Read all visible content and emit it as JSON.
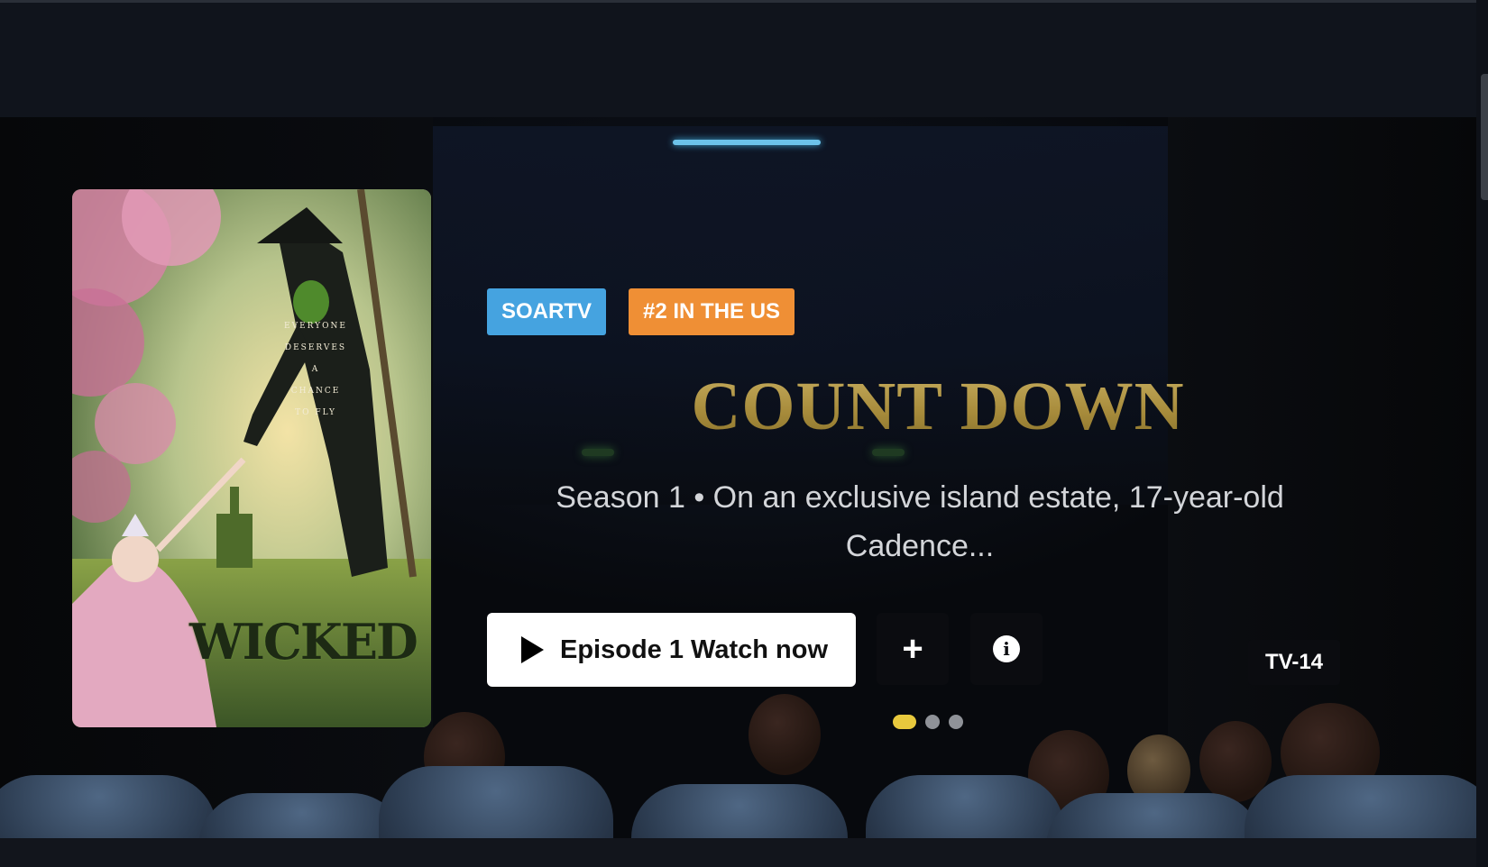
{
  "hero": {
    "badges": [
      "SOARTV",
      "#2 IN THE US"
    ],
    "title": "COUNT DOWN",
    "description": "Season 1 • On an exclusive island estate, 17-year-old Cadence...",
    "watch_button_label": "Episode 1 Watch now",
    "add_button_symbol": "+",
    "info_button_symbol": "i",
    "rating": "TV-14",
    "carousel": {
      "total_slides": 3,
      "active_index": 0
    }
  },
  "poster": {
    "title": "WICKED",
    "tagline": [
      "EVERYONE",
      "DESERVES",
      "A",
      "CHANCE",
      "TO FLY"
    ]
  },
  "colors": {
    "badge_blue": "#45a3e0",
    "badge_orange": "#ef8f35",
    "title_gold": "#b9a04e",
    "active_dot": "#e8c93d",
    "progress_line": "#6cc3ea"
  }
}
